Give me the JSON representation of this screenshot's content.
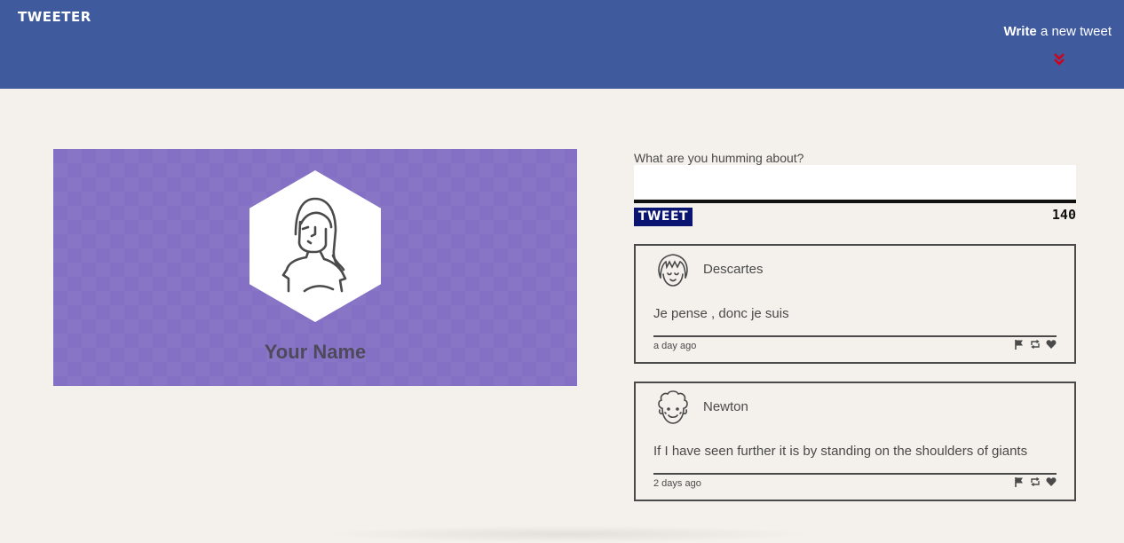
{
  "header": {
    "brand": "TWEETER",
    "compose_strong": "Write",
    "compose_rest": " a new tweet",
    "background_color": "#3f5b9d",
    "chevron_color": "#d0021b"
  },
  "profile": {
    "name": "Your Name",
    "background_color": "#8470c4"
  },
  "compose": {
    "prompt": "What are you humming about?",
    "textarea_value": "",
    "button_label": "TWEET",
    "counter": "140"
  },
  "tweets": [
    {
      "author": "Descartes",
      "content": "Je pense , donc je suis",
      "time": "a day ago",
      "avatar_icon": "girl-bangs-avatar-icon"
    },
    {
      "author": "Newton",
      "content": "If I have seen further it is by standing on the shoulders of giants",
      "time": "2 days ago",
      "avatar_icon": "curly-hair-avatar-icon"
    }
  ],
  "tweet_actions": [
    "flag-icon",
    "retweet-icon",
    "heart-icon"
  ]
}
